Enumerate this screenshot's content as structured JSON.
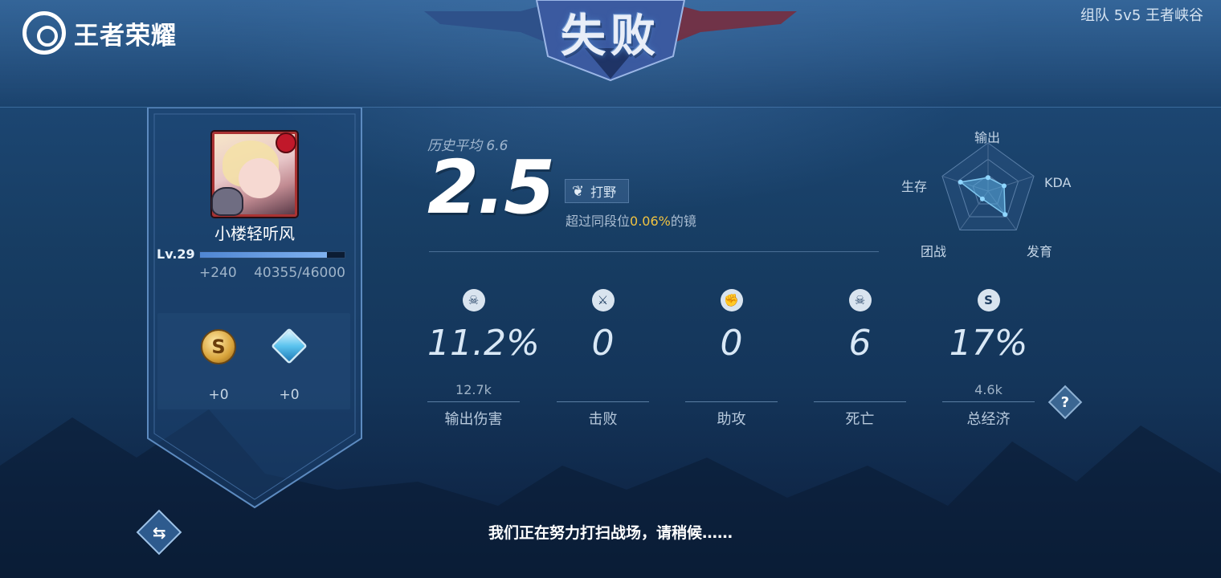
{
  "app": {
    "logo_text": "王者荣耀"
  },
  "mode_label": "组队 5v5 王者峡谷",
  "result_title": "失败",
  "player": {
    "name": "小楼轻听风",
    "level": "Lv.29",
    "xp_gain": "+240",
    "xp_progress": "40355/46000",
    "xp_fraction": 0.877
  },
  "rewards": [
    {
      "icon": "gold-coin-icon",
      "value": "+0"
    },
    {
      "icon": "diamond-gem-icon",
      "value": "+0"
    }
  ],
  "score": {
    "history_avg": "历史平均 6.6",
    "value": "2.5",
    "role": "打野",
    "surpass_prefix": "超过同段位",
    "surpass_percent": "0.06%",
    "surpass_suffix": "的镜"
  },
  "radar": {
    "labels": [
      "输出",
      "KDA",
      "发育",
      "团战",
      "生存"
    ],
    "values": [
      0.28,
      0.35,
      0.6,
      0.2,
      0.6
    ]
  },
  "stats": [
    {
      "icon": "damage-icon",
      "glyph": "☠",
      "value": "11.2%",
      "sub": "12.7k",
      "label": "输出伤害"
    },
    {
      "icon": "sword-icon",
      "glyph": "⚔",
      "value": "0",
      "sub": "",
      "label": "击败"
    },
    {
      "icon": "fist-icon",
      "glyph": "✊",
      "value": "0",
      "sub": "",
      "label": "助攻"
    },
    {
      "icon": "skull-icon",
      "glyph": "☠",
      "value": "6",
      "sub": "",
      "label": "死亡"
    },
    {
      "icon": "gold-icon",
      "glyph": "S",
      "value": "17%",
      "sub": "4.6k",
      "label": "总经济"
    }
  ],
  "help_label": "?",
  "status_text": "我们正在努力打扫战场，请稍候……",
  "colors": {
    "highlight": "#f1c341",
    "background": "#173d63"
  }
}
